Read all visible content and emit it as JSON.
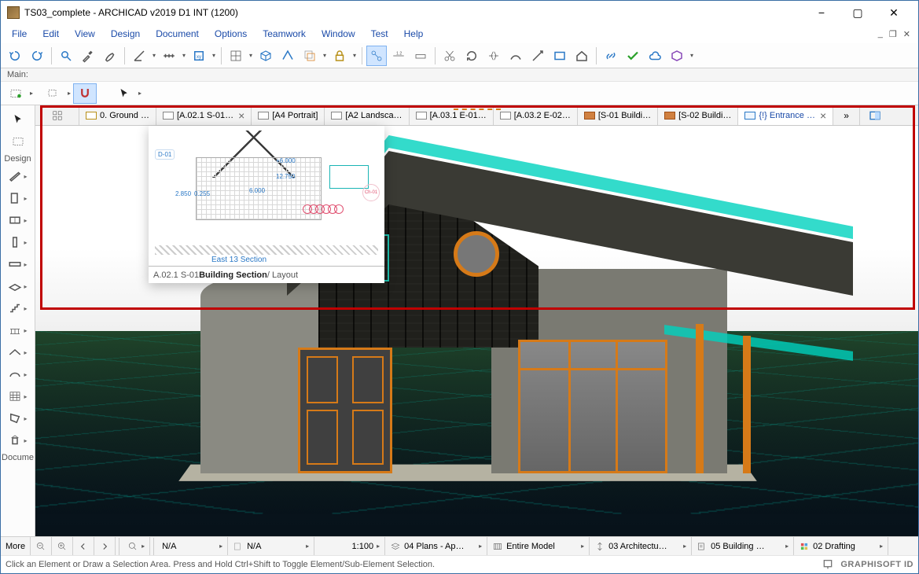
{
  "title": "TS03_complete - ARCHICAD v2019 D1 INT (1200)",
  "window": {
    "min": "−",
    "max": "▢",
    "close": "✕",
    "mini_min": "_",
    "mini_max": "❐",
    "mini_close": "✕"
  },
  "menu": [
    "File",
    "Edit",
    "View",
    "Design",
    "Document",
    "Options",
    "Teamwork",
    "Window",
    "Test",
    "Help"
  ],
  "main_label": "Main:",
  "side": {
    "section_design": "Design",
    "section_docu": "Docume",
    "more": "More"
  },
  "tabs": [
    {
      "label": "0. Ground …",
      "icon": "folder"
    },
    {
      "label": "[A.02.1 S-01…",
      "icon": "layout",
      "close": true
    },
    {
      "label": "[A4 Portrait]",
      "icon": "layout"
    },
    {
      "label": "[A2 Landsca…",
      "icon": "layout"
    },
    {
      "label": "[A.03.1 E-01…",
      "icon": "layout"
    },
    {
      "label": "[A.03.2 E-02…",
      "icon": "layout"
    },
    {
      "label": "[S-01 Buildi…",
      "icon": "section"
    },
    {
      "label": "[S-02 Buildi…",
      "icon": "section"
    },
    {
      "label": "{!} Entrance …",
      "icon": "3d",
      "active": true,
      "close": true
    }
  ],
  "preview": {
    "caption": "East 13 Section",
    "dims": {
      "a": "2.850",
      "b": "0.255",
      "c": "6.000",
      "d": "12.750",
      "e": "+6.000",
      "label_d": "D-01",
      "label_c": "Ch-01"
    },
    "tooltip_prefix": "A.02.1 S-01 ",
    "tooltip_bold": "Building Section",
    "tooltip_suffix": " / Layout"
  },
  "bottom": {
    "more": "More",
    "na1": "N/A",
    "na2": "N/A",
    "scale": "1:100",
    "plans": "04 Plans - Ap…",
    "model": "Entire Model",
    "arch": "03 Architectu…",
    "building": "05 Building …",
    "drafting": "02 Drafting"
  },
  "status": {
    "hint": "Click an Element or Draw a Selection Area. Press and Hold Ctrl+Shift to Toggle Element/Sub-Element Selection.",
    "brand": "GRAPHISOFT ID"
  }
}
